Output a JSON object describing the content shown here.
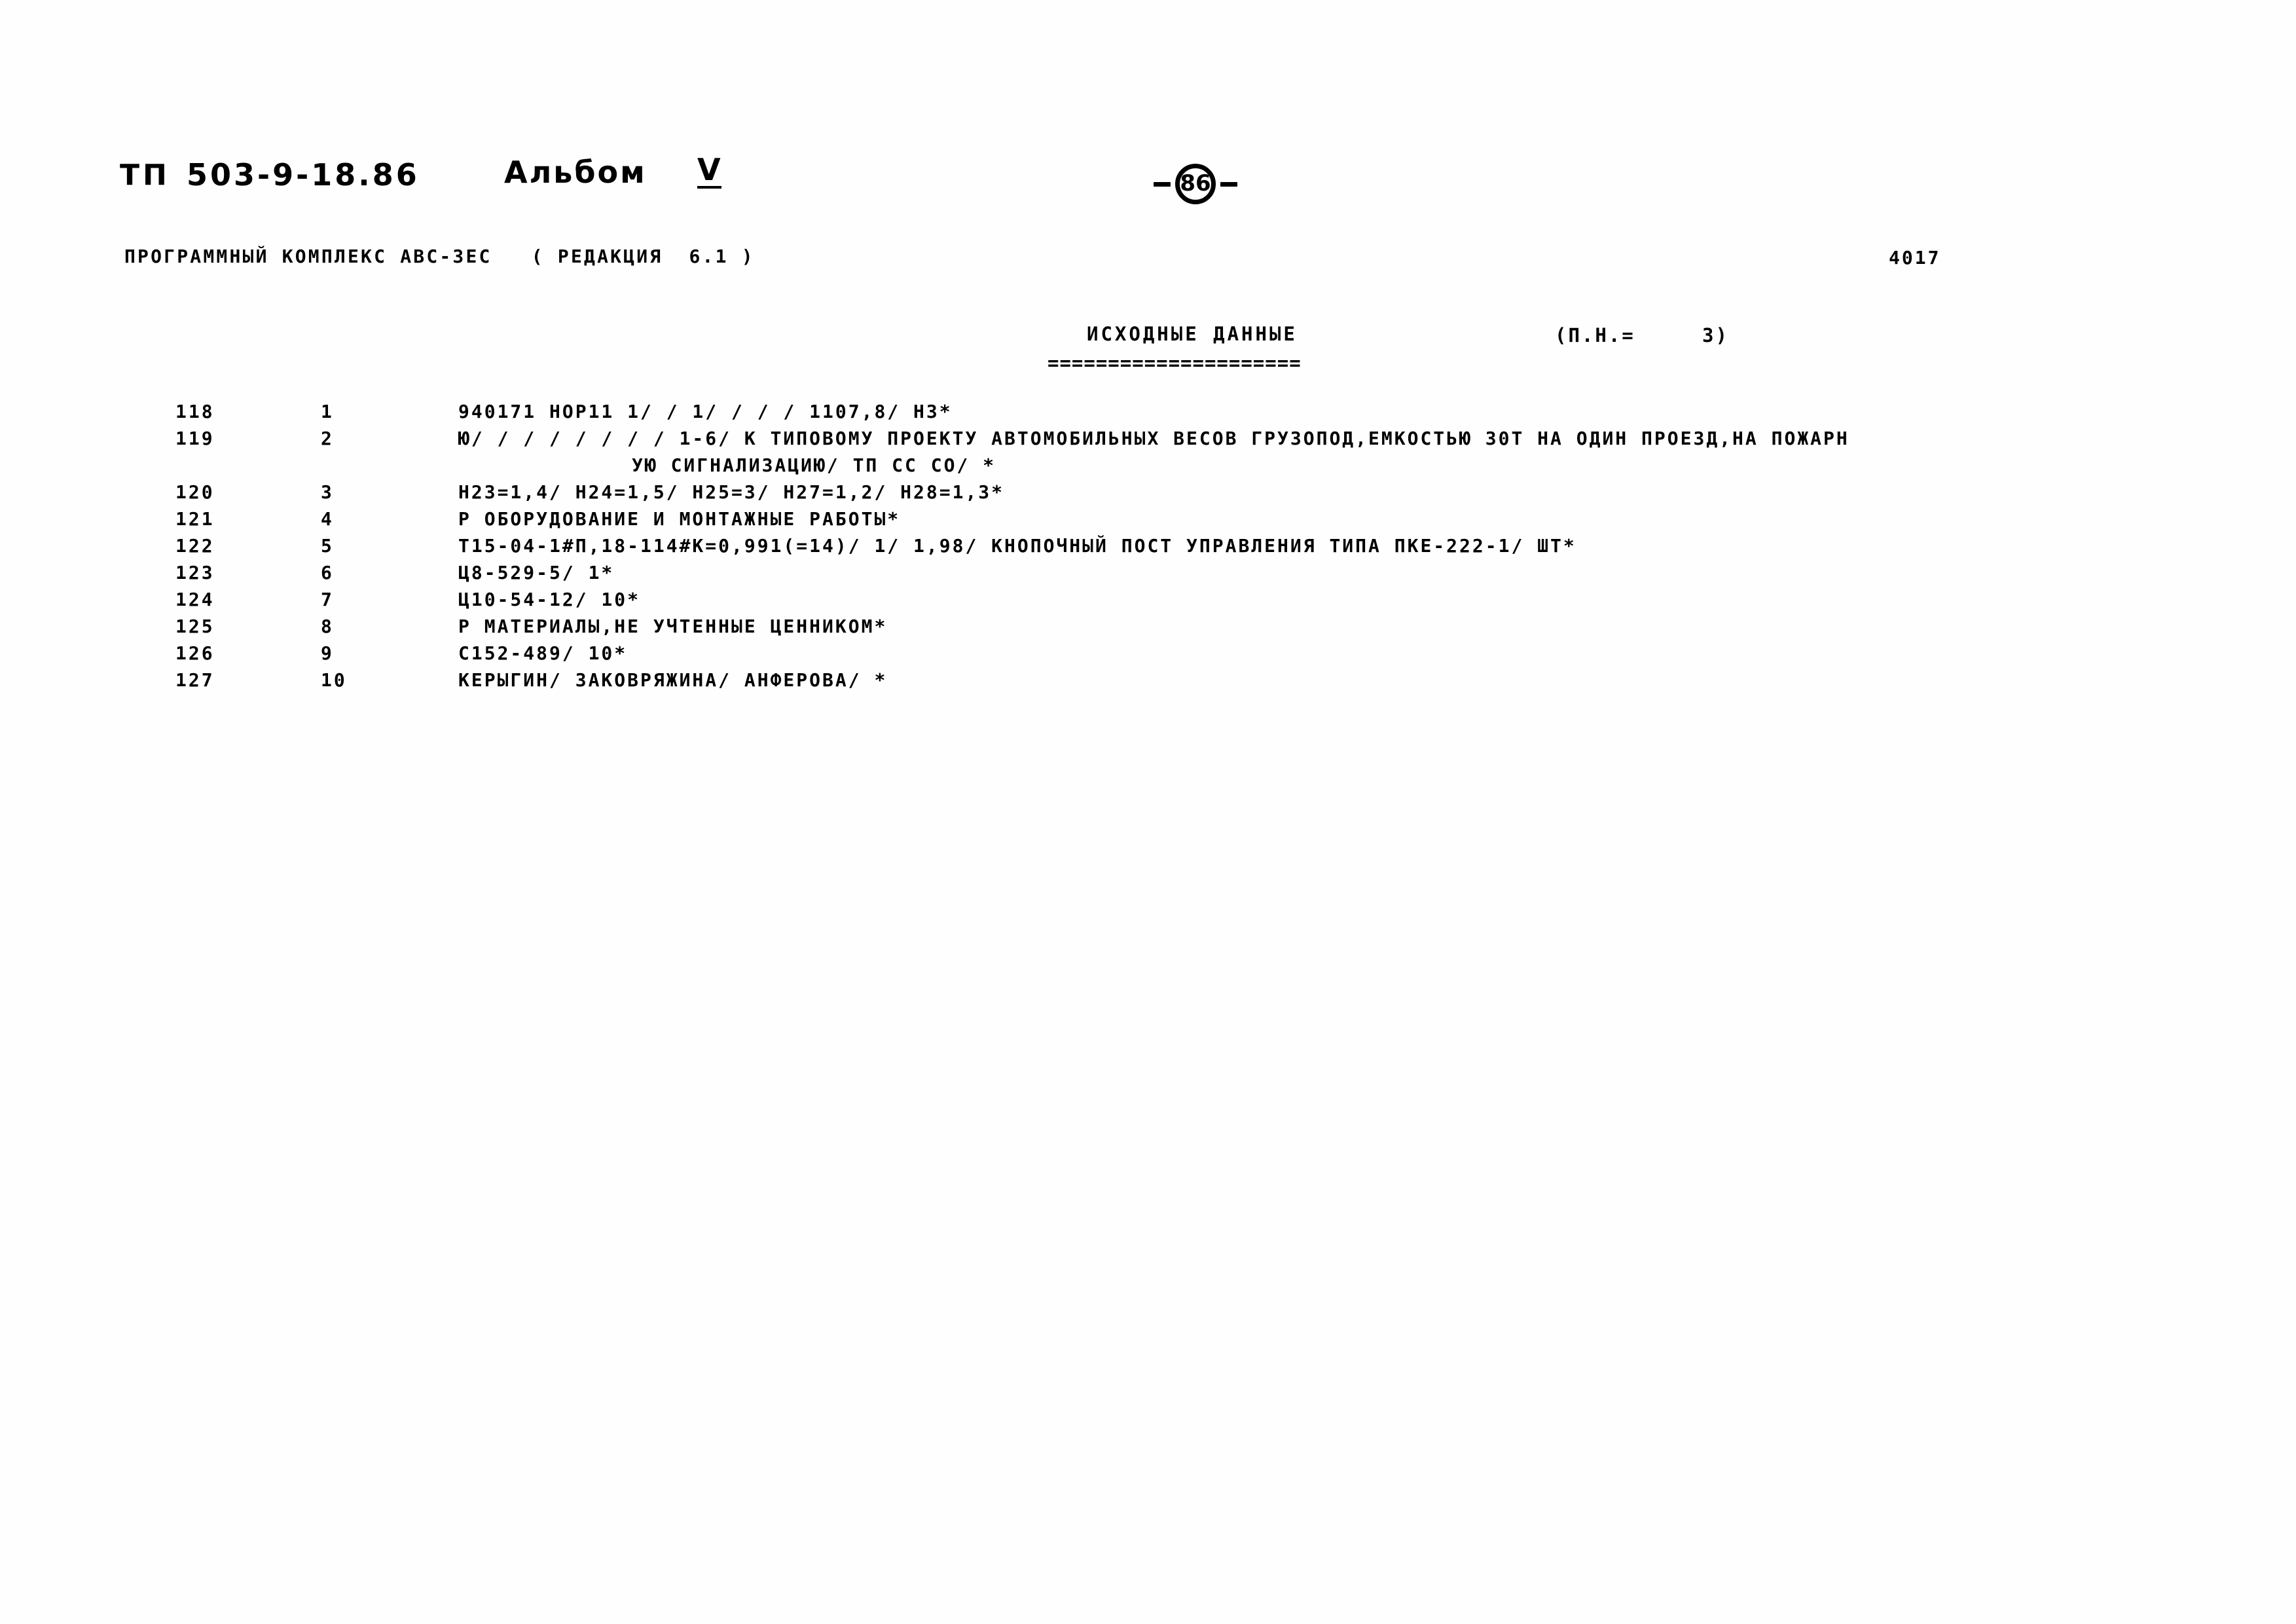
{
  "header": {
    "series_prefix": "ТП",
    "project_code": "503-9-18.86",
    "album_label": "Альбом",
    "album_number": "V",
    "page_number": "86",
    "software_line": "ПРОГРАММНЫЙ КОМПЛЕКС АВС-ЗЕС   ( РЕДАКЦИЯ  6.1 )",
    "right_code": "4017"
  },
  "section": {
    "title": "ИСХОДНЫЕ ДАННЫЕ",
    "title_rule": "=====================",
    "page_counter": "(П.Н.=     3)"
  },
  "listing": {
    "rows": [
      {
        "line": "118",
        "seq": "1",
        "text": "940171 НОР11 1/ / 1/ / / / 1107,8/ Н3*",
        "continuation": false
      },
      {
        "line": "119",
        "seq": "2",
        "text": "Ю/ / / / / / / / 1-6/ К ТИПОВОМУ ПРОЕКТУ АВТОМОБИЛЬНЫХ ВЕСОВ ГРУЗОПОД,ЕМКОСТЬЮ 30Т НА ОДИН ПРОЕЗД,НА ПОЖАРН",
        "continuation": false
      },
      {
        "line": "",
        "seq": "",
        "text": "УЮ СИГНАЛИЗАЦИЮ/ ТП СС СО/ *",
        "continuation": true
      },
      {
        "line": "120",
        "seq": "3",
        "text": "Н23=1,4/ Н24=1,5/ Н25=3/ Н27=1,2/ Н28=1,3*",
        "continuation": false
      },
      {
        "line": "121",
        "seq": "4",
        "text": "Р ОБОРУДОВАНИЕ И МОНТАЖНЫЕ РАБОТЫ*",
        "continuation": false
      },
      {
        "line": "122",
        "seq": "5",
        "text": "Т15-04-1#П,18-114#К=0,991(=14)/ 1/ 1,98/  КНОПОЧНЫЙ ПОСТ УПРАВЛЕНИЯ ТИПА ПКЕ-222-1/ ШТ*",
        "continuation": false
      },
      {
        "line": "123",
        "seq": "6",
        "text": "Ц8-529-5/ 1*",
        "continuation": false
      },
      {
        "line": "124",
        "seq": "7",
        "text": "Ц10-54-12/ 10*",
        "continuation": false
      },
      {
        "line": "125",
        "seq": "8",
        "text": "Р МАТЕРИАЛЫ,НЕ УЧТЕННЫЕ ЦЕННИКОМ*",
        "continuation": false
      },
      {
        "line": "126",
        "seq": "9",
        "text": "С152-489/ 10*",
        "continuation": false
      },
      {
        "line": "127",
        "seq": "10",
        "text": "КЕРЫГИН/ ЗАКОВРЯЖИНА/ АНФЕРОВА/ *",
        "continuation": false
      }
    ]
  }
}
